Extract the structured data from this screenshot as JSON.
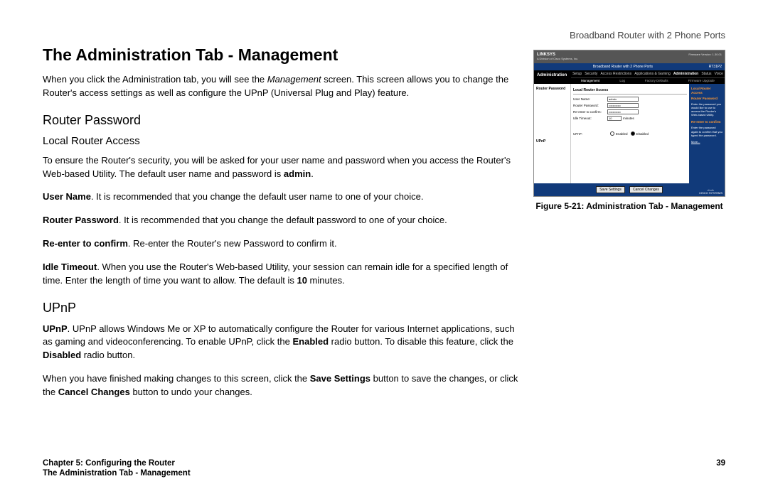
{
  "header": {
    "product": "Broadband Router with 2 Phone Ports"
  },
  "title": "The Administration Tab - Management",
  "intro_pre": "When you click the Administration tab, you will see the ",
  "intro_em": "Management",
  "intro_post": " screen. This screen allows you to change the Router's access settings as well as configure the UPnP (Universal Plug and Play) feature.",
  "h2_router_password": "Router Password",
  "h3_local_access": "Local Router Access",
  "para_access_pre": "To ensure the Router's security, you will be asked for your user name and password when you access the Router's Web-based Utility. The default user name and password is ",
  "para_access_bold": "admin",
  "para_access_post": ".",
  "un_bold": "User Name",
  "un_text": ". It is recommended that you change the default user name to one of your choice.",
  "rp_bold": "Router Password",
  "rp_text": ". It is recommended that you change the default password to one of your choice.",
  "re_bold": "Re-enter to confirm",
  "re_text": ". Re-enter the Router's new Password to confirm it.",
  "idle_bold": "Idle Timeout",
  "idle_text_pre": ". When you use the Router's Web-based Utility, your session can remain idle for a specified length of time. Enter the length of time you want to allow. The default is ",
  "idle_text_bold": "10",
  "idle_text_post": " minutes.",
  "h2_upnp": "UPnP",
  "upnp_bold": "UPnP",
  "upnp_text_pre": ". UPnP allows Windows Me or XP to automatically configure the Router for various Internet applications, such as gaming and videoconferencing. To enable UPnP, click the ",
  "upnp_enabled": "Enabled",
  "upnp_text_mid": " radio button. To disable this feature, click the ",
  "upnp_disabled": "Disabled",
  "upnp_text_post": " radio button.",
  "save_para_pre": "When you have finished making changes to this screen, click the ",
  "save_btn": "Save Settings",
  "save_para_mid": " button to save the changes, or click the ",
  "cancel_btn": "Cancel Changes",
  "save_para_post": " button to undo your changes.",
  "figure_caption": "Figure 5-21: Administration Tab - Management",
  "footer": {
    "chapter": "Chapter 5: Configuring the Router",
    "page": "39",
    "subtitle": "The Administration Tab - Management"
  },
  "ui": {
    "brand": "LINKSYS",
    "brand_sub": "A Division of Cisco Systems, Inc.",
    "titlebar": "Broadband Router with 2 Phone Ports",
    "model": "RT31P2",
    "fw": "Firmware Version: 1.30.01",
    "section_label": "Administration",
    "tabs": [
      "Setup",
      "Security",
      "Access Restrictions",
      "Applications & Gaming",
      "Administration",
      "Status",
      "Voice"
    ],
    "subtabs": [
      "Management",
      "Log",
      "Factory Defaults",
      "Firmware Upgrade"
    ],
    "left_labels": {
      "rp": "Router Password",
      "upnp": "UPnP"
    },
    "center": {
      "sec1": "Local Router Access",
      "user_name_k": "User Name:",
      "user_name_v": "admin",
      "router_pw_k": "Router Password:",
      "router_pw_v": "••••••••••••",
      "reenter_k": "Re-enter to confirm:",
      "reenter_v": "••••••••••••",
      "idle_k": "Idle Timeout:",
      "idle_v": "10",
      "idle_unit": "minutes",
      "upnp_k": "UPnP:",
      "enabled": "Enabled",
      "disabled": "Disabled"
    },
    "right": {
      "h_local": "Local Router Access",
      "h_rp": "Router Password",
      "rp_help": "Enter the password you would like to use to access the Router's Web-based Utility.",
      "h_re": "Re-enter to confirm",
      "re_help": "Enter the password again to confirm that you typed the password.",
      "more": "More..."
    },
    "buttons": {
      "save": "Save Settings",
      "cancel": "Cancel Changes"
    },
    "cisco": "CISCO SYSTEMS"
  }
}
